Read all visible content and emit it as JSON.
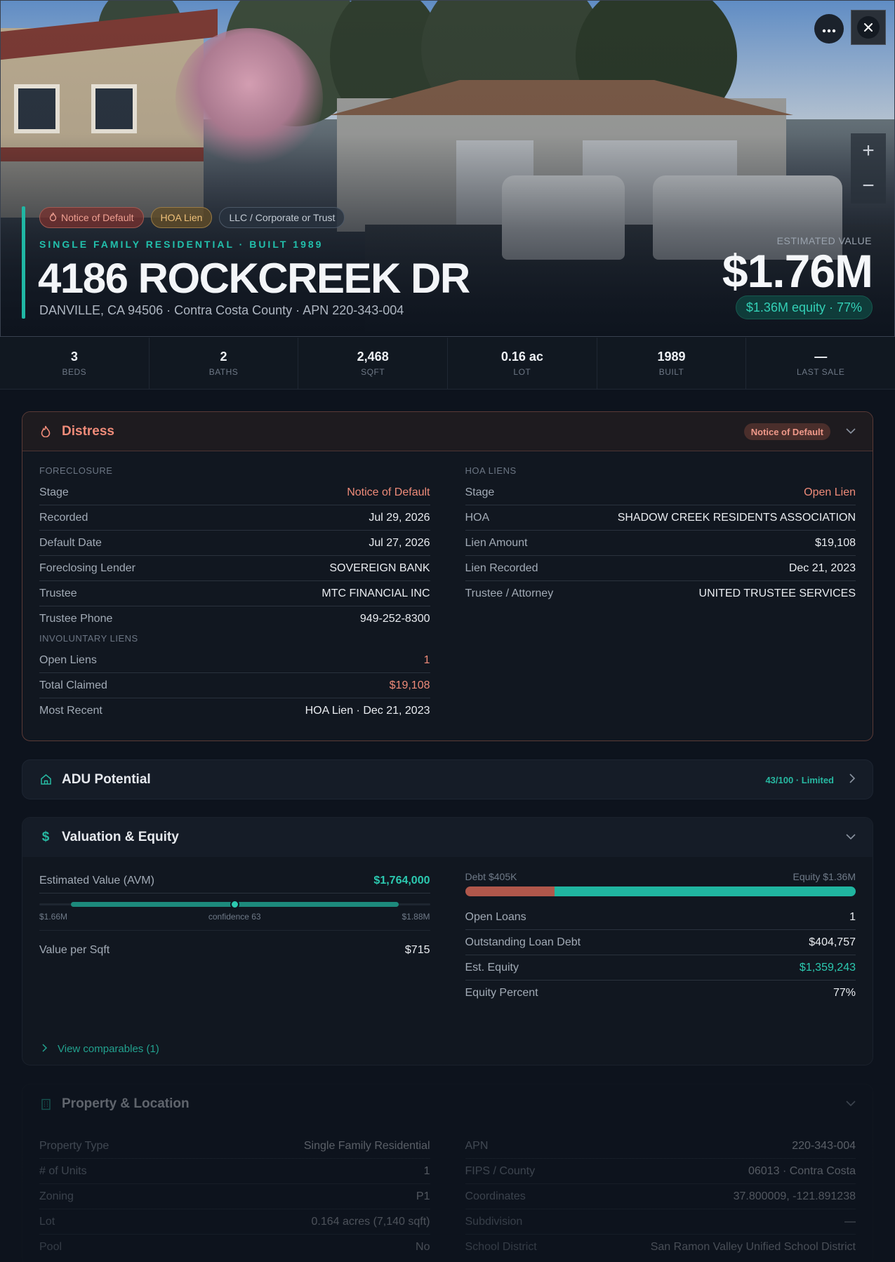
{
  "hero": {
    "tags": [
      "Notice of Default",
      "HOA Lien",
      "LLC / Corporate or Trust"
    ],
    "subtype": "SINGLE FAMILY RESIDENTIAL · BUILT 1989",
    "address": "4186 ROCKCREEK DR",
    "sub_address": "DANVILLE, CA 94506 · Contra Costa County · APN 220-343-004",
    "est_label": "ESTIMATED VALUE",
    "est_value": "$1.76M",
    "equity_pill": "$1.36M equity · 77%",
    "more_icon": "ellipsis-icon",
    "close_icon": "close-icon",
    "zoom_in": "+",
    "zoom_out": "−"
  },
  "stats": [
    {
      "value": "3",
      "label": "BEDS"
    },
    {
      "value": "2",
      "label": "BATHS"
    },
    {
      "value": "2,468",
      "label": "SQFT"
    },
    {
      "value": "0.16 ac",
      "label": "LOT"
    },
    {
      "value": "1989",
      "label": "BUILT"
    },
    {
      "value": "—",
      "label": "LAST SALE"
    }
  ],
  "distress": {
    "title": "Distress",
    "badge": "Notice of Default",
    "foreclosure_label": "FORECLOSURE",
    "foreclosure": [
      {
        "k": "Stage",
        "v": "Notice of Default"
      },
      {
        "k": "Recorded",
        "v": "Jul 29, 2026"
      },
      {
        "k": "Default Date",
        "v": "Jul 27, 2026"
      },
      {
        "k": "Foreclosing Lender",
        "v": "SOVEREIGN BANK"
      },
      {
        "k": "Trustee",
        "v": "MTC FINANCIAL INC"
      },
      {
        "k": "Trustee Phone",
        "v": "949-252-8300"
      }
    ],
    "involuntary_label": "INVOLUNTARY LIENS",
    "involuntary": [
      {
        "k": "Open Liens",
        "v": "1"
      },
      {
        "k": "Total Claimed",
        "v": "$19,108"
      },
      {
        "k": "Most Recent",
        "v": "HOA Lien · Dec 21, 2023"
      }
    ],
    "hoa_label": "HOA LIENS",
    "hoa": [
      {
        "k": "Stage",
        "v": "Open Lien"
      },
      {
        "k": "HOA",
        "v": "SHADOW CREEK RESIDENTS ASSOCIATION"
      },
      {
        "k": "Lien Amount",
        "v": "$19,108"
      },
      {
        "k": "Lien Recorded",
        "v": "Dec 21, 2023"
      },
      {
        "k": "Trustee / Attorney",
        "v": "UNITED TRUSTEE SERVICES"
      }
    ]
  },
  "adu": {
    "title": "ADU Potential",
    "score": "43/100 · Limited"
  },
  "valuation": {
    "title": "Valuation & Equity",
    "avm_label": "Estimated Value (AVM)",
    "avm_value": "$1,764,000",
    "range_low": "$1.66M",
    "range_high": "$1.88M",
    "confidence": "confidence 63",
    "avm_position": 0.5,
    "per_sqft_label": "Value per Sqft",
    "per_sqft_value": "$715",
    "debt_label": "Debt $405K",
    "equity_label": "Equity $1.36M",
    "debt_fraction": 0.23,
    "rows": [
      {
        "k": "Open Loans",
        "v": "1"
      },
      {
        "k": "Outstanding Loan Debt",
        "v": "$404,757"
      },
      {
        "k": "Est. Equity",
        "v": "$1,359,243"
      },
      {
        "k": "Equity Percent",
        "v": "77%"
      }
    ],
    "comps": "View comparables (1)"
  },
  "property": {
    "title": "Property & Location",
    "left": [
      {
        "k": "Property Type",
        "v": "Single Family Residential"
      },
      {
        "k": "# of Units",
        "v": "1"
      },
      {
        "k": "Zoning",
        "v": "P1"
      },
      {
        "k": "Lot",
        "v": "0.164 acres (7,140 sqft)"
      },
      {
        "k": "Pool",
        "v": "No"
      }
    ],
    "right": [
      {
        "k": "APN",
        "v": "220-343-004"
      },
      {
        "k": "FIPS / County",
        "v": "06013 · Contra Costa"
      },
      {
        "k": "Coordinates",
        "v": "37.800009, -121.891238"
      },
      {
        "k": "Subdivision",
        "v": "—"
      },
      {
        "k": "School District",
        "v": "San Ramon Valley Unified School District"
      }
    ]
  },
  "colors": {
    "accent": "#20b7a4",
    "distress": "#ef8b79",
    "debt": "#b0574b",
    "equity": "#20b5a0"
  }
}
